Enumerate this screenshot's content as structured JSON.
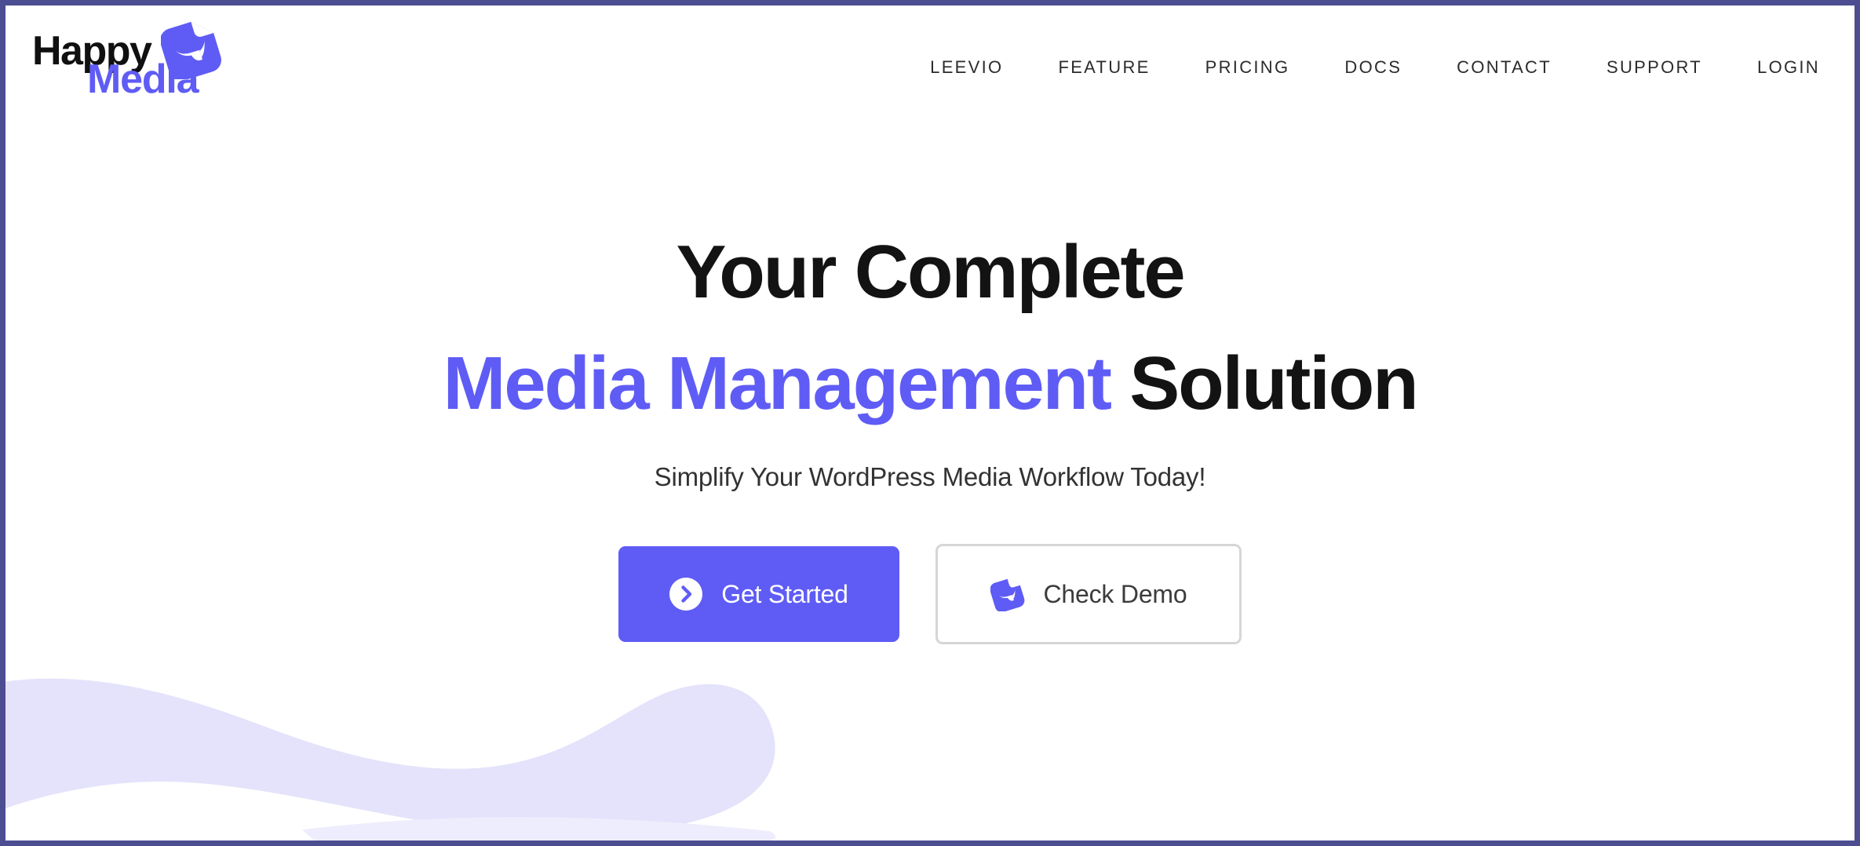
{
  "theme": {
    "accent": "#5f5cf5",
    "frame_border": "#4d4d91",
    "blob": "#e4e3fb",
    "heading_color": "#131313",
    "nav_color": "#2b2b2b",
    "demo_border": "#d6d6d6"
  },
  "header": {
    "logo": {
      "line1": "Happy",
      "line2": "Media",
      "mark_icon": "happy-media-mark-icon"
    },
    "nav": [
      {
        "label": "LEEVIO"
      },
      {
        "label": "FEATURE"
      },
      {
        "label": "PRICING"
      },
      {
        "label": "DOCS"
      },
      {
        "label": "CONTACT"
      },
      {
        "label": "SUPPORT"
      },
      {
        "label": "LOGIN"
      }
    ]
  },
  "hero": {
    "headline_line1": "Your Complete",
    "headline_line2_accent": "Media Management",
    "headline_line2_rest": " Solution",
    "subheadline": "Simplify Your WordPress Media Workflow Today!",
    "primary_cta": {
      "label": "Get Started",
      "icon": "arrow-right-circle-icon"
    },
    "secondary_cta": {
      "label": "Check Demo",
      "icon": "happy-media-mark-icon"
    }
  }
}
